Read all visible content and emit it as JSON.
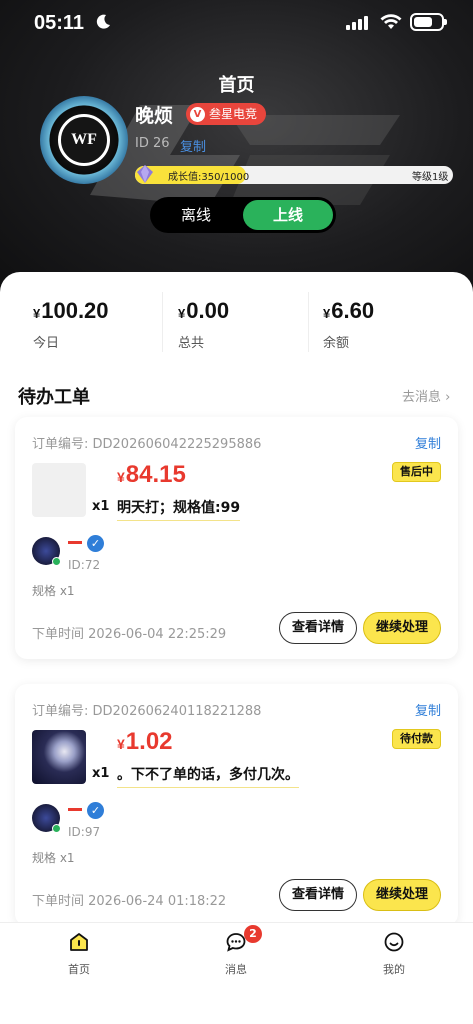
{
  "status_bar": {
    "time": "05:11"
  },
  "header": {
    "title": "首页",
    "user_name": "晚烦",
    "club_badge": "叁星电竞",
    "club_badge_letter": "V",
    "avatar_text": "WF",
    "user_id": "ID 26",
    "copy_id": "复制",
    "growth_text": "成长值:350/1000",
    "growth_progress": 0.35,
    "level_text": "等级1级",
    "toggle_off": "离线",
    "toggle_on": "上线"
  },
  "stats": [
    {
      "currency": "¥",
      "amount": "100.20",
      "label": "今日"
    },
    {
      "currency": "¥",
      "amount": "0.00",
      "label": "总共"
    },
    {
      "currency": "¥",
      "amount": "6.60",
      "label": "余额"
    }
  ],
  "section": {
    "title": "待办工单",
    "link": "去消息 ›"
  },
  "orders": [
    {
      "order_no": "订单编号: DD202606042225295886",
      "copy": "复制",
      "currency": "¥",
      "price": "84.15",
      "qty": "x1",
      "desc": "明天打；规格值:99",
      "status": "售后中",
      "buyer_name": "—",
      "buyer_id": "ID:72",
      "spec": "规格 x1",
      "time": "下单时间 2026-06-04 22:25:29",
      "btn_detail": "查看详情",
      "btn_continue": "继续处理"
    },
    {
      "order_no": "订单编号: DD202606240118221288",
      "copy": "复制",
      "currency": "¥",
      "price": "1.02",
      "qty": "x1",
      "desc": "。下不了单的话，多付几次。",
      "status": "待付款",
      "buyer_name": "—",
      "buyer_id": "ID:97",
      "spec": "规格 x1",
      "time": "下单时间 2026-06-24 01:18:22",
      "btn_detail": "查看详情",
      "btn_continue": "继续处理"
    }
  ],
  "tabbar": [
    {
      "label": "首页",
      "icon": "home-icon"
    },
    {
      "label": "消息",
      "icon": "message-icon",
      "badge": "2"
    },
    {
      "label": "我的",
      "icon": "profile-icon"
    }
  ],
  "colors": {
    "accent": "#fbe54d",
    "price": "#e8392e",
    "online": "#2ab25b",
    "link": "#2f7ed8"
  }
}
